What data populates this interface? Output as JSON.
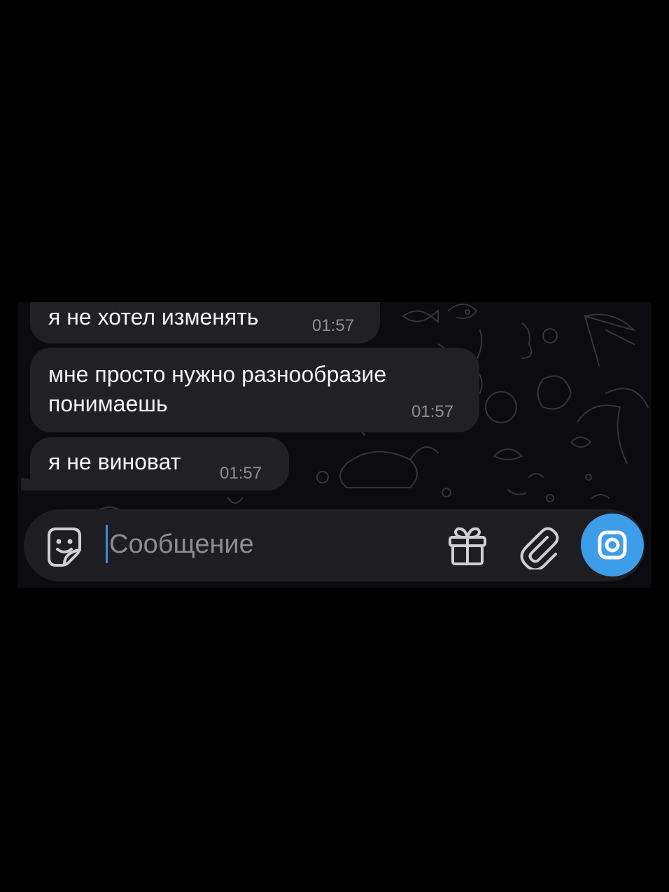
{
  "messages": [
    {
      "text": "я не хотел изменять",
      "time": "01:57"
    },
    {
      "text": "мне просто нужно разнообразие\nпонимаешь",
      "time": "01:57"
    },
    {
      "text": "я не виноват",
      "time": "01:57"
    }
  ],
  "composer": {
    "placeholder": "Сообщение",
    "value": "",
    "icons": {
      "sticker": "sticker-smile-icon",
      "gift": "gift-icon",
      "attach": "paperclip-icon",
      "camera": "camera-icon"
    }
  },
  "colors": {
    "background": "#000000",
    "chat_background": "#0c0c10",
    "bubble": "#212125",
    "accent": "#3e9de9",
    "timestamp": "#8e8e93"
  }
}
